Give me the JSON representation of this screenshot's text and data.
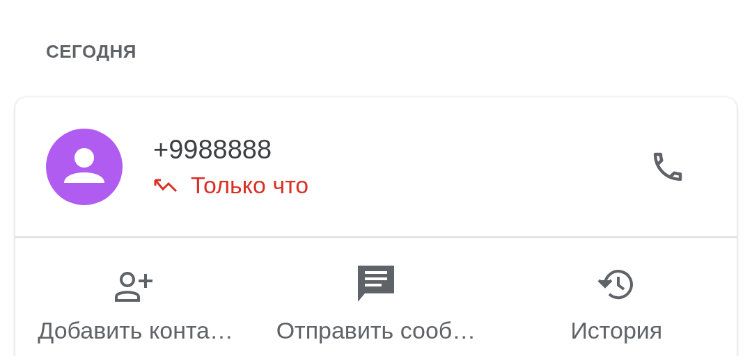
{
  "section_header": "СЕГОДНЯ",
  "call": {
    "number": "+9988888",
    "kind": "missed",
    "time": "Только что"
  },
  "actions": [
    {
      "kind": "add-contact",
      "label": "Добавить конта…"
    },
    {
      "kind": "message",
      "label": "Отправить сооб…"
    },
    {
      "kind": "history",
      "label": "История"
    }
  ]
}
